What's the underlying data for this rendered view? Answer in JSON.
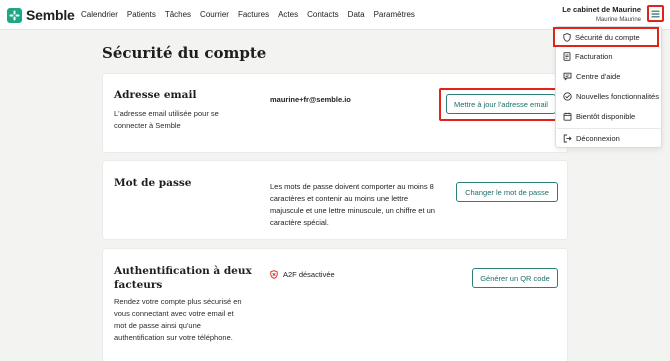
{
  "app": {
    "brand": "Semble"
  },
  "nav": {
    "items": [
      "Calendrier",
      "Patients",
      "Tâches",
      "Courrier",
      "Factures",
      "Actes",
      "Contacts",
      "Data",
      "Paramètres"
    ]
  },
  "account": {
    "practice": "Le cabinet de Maurine",
    "user": "Maurine Maurine"
  },
  "menu": {
    "items": [
      {
        "label": "Sécurité du compte",
        "icon": "shield-icon"
      },
      {
        "label": "Facturation",
        "icon": "receipt-icon"
      },
      {
        "label": "Centre d'aide",
        "icon": "chat-help-icon"
      },
      {
        "label": "Nouvelles fonctionnalités",
        "icon": "check-circle-icon"
      },
      {
        "label": "Bientôt disponible",
        "icon": "calendar-icon"
      },
      {
        "label": "Déconnexion",
        "icon": "logout-icon"
      }
    ]
  },
  "page": {
    "title": "Sécurité du compte"
  },
  "email_section": {
    "title": "Adresse email",
    "description": "L'adresse email utilisée pour se connecter à Semble",
    "value": "maurine+fr@semble.io",
    "button": "Mettre à jour l'adresse email"
  },
  "password_section": {
    "title": "Mot de passe",
    "info": "Les mots de passe doivent comporter au moins 8 caractères et contenir au moins une lettre majuscule et une lettre minuscule, un chiffre et un caractère spécial.",
    "button": "Changer le mot de passe"
  },
  "twofa_section": {
    "title": "Authentification à deux facteurs",
    "description": "Rendez votre compte plus sécurisé en vous connectant avec votre email et mot de passe ainsi qu'une authentification sur votre téléphone.",
    "status": "A2F désactivée",
    "button": "Générer un QR code"
  },
  "colors": {
    "brand": "#1fa783",
    "accent": "#1d6f6a",
    "highlight": "#e2231a",
    "status_off": "#d9342b"
  }
}
